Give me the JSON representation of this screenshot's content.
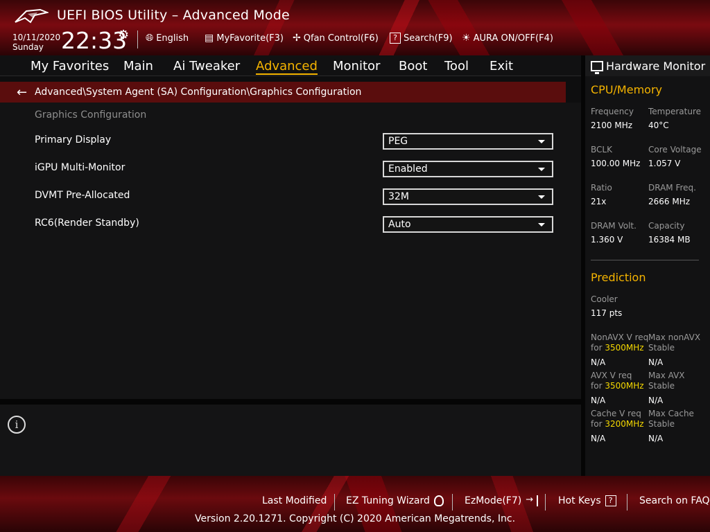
{
  "header": {
    "title": "UEFI BIOS Utility – Advanced Mode",
    "date": "10/11/2020",
    "day": "Sunday",
    "time": "22:33",
    "language": "English",
    "myfavorite": "MyFavorite(F3)",
    "qfan": "Qfan Control(F6)",
    "search": "Search(F9)",
    "aura": "AURA ON/OFF(F4)"
  },
  "nav": {
    "tabs": [
      "My Favorites",
      "Main",
      "Ai Tweaker",
      "Advanced",
      "Monitor",
      "Boot",
      "Tool",
      "Exit"
    ],
    "active": "Advanced"
  },
  "breadcrumb": "Advanced\\System Agent (SA) Configuration\\Graphics Configuration",
  "main": {
    "section_title": "Graphics Configuration",
    "settings": [
      {
        "label": "Primary Display",
        "value": "PEG"
      },
      {
        "label": "iGPU Multi-Monitor",
        "value": "Enabled"
      },
      {
        "label": "DVMT Pre-Allocated",
        "value": "32M"
      },
      {
        "label": "RC6(Render Standby)",
        "value": "Auto"
      }
    ]
  },
  "hardware_monitor": {
    "title": "Hardware Monitor",
    "cpu_memory": {
      "title": "CPU/Memory",
      "frequency_label": "Frequency",
      "frequency": "2100 MHz",
      "temperature_label": "Temperature",
      "temperature": "40°C",
      "bclk_label": "BCLK",
      "bclk": "100.00 MHz",
      "core_voltage_label": "Core Voltage",
      "core_voltage": "1.057 V",
      "ratio_label": "Ratio",
      "ratio": "21x",
      "dram_freq_label": "DRAM Freq.",
      "dram_freq": "2666 MHz",
      "dram_volt_label": "DRAM Volt.",
      "dram_volt": "1.360 V",
      "capacity_label": "Capacity",
      "capacity": "16384 MB"
    },
    "prediction": {
      "title": "Prediction",
      "cooler_label": "Cooler",
      "cooler": "117 pts",
      "nonavx_label": "NonAVX V req",
      "for_label": "for",
      "nonavx_freq": "3500MHz",
      "nonavx_val": "N/A",
      "max_nonavx_label_1": "Max nonAVX",
      "stable_label": "Stable",
      "max_nonavx_val": "N/A",
      "avx_label": "AVX V req",
      "avx_freq": "3500MHz",
      "avx_val": "N/A",
      "max_avx_label": "Max AVX",
      "max_avx_val": "N/A",
      "cache_label": "Cache V req",
      "cache_freq": "3200MHz",
      "cache_val": "N/A",
      "max_cache_label": "Max Cache",
      "max_cache_val": "N/A"
    }
  },
  "footer": {
    "last_modified": "Last Modified",
    "ez_tuning": "EZ Tuning Wizard",
    "ezmode": "EzMode(F7)",
    "hotkeys": "Hot Keys",
    "search_faq": "Search on FAQ",
    "copyright": "Version 2.20.1271. Copyright (C) 2020 American Megatrends, Inc."
  },
  "colors": {
    "accent": "#f5b400",
    "highlight": "#f5d800",
    "breadcrumb_bg": "#5a0d0d"
  }
}
